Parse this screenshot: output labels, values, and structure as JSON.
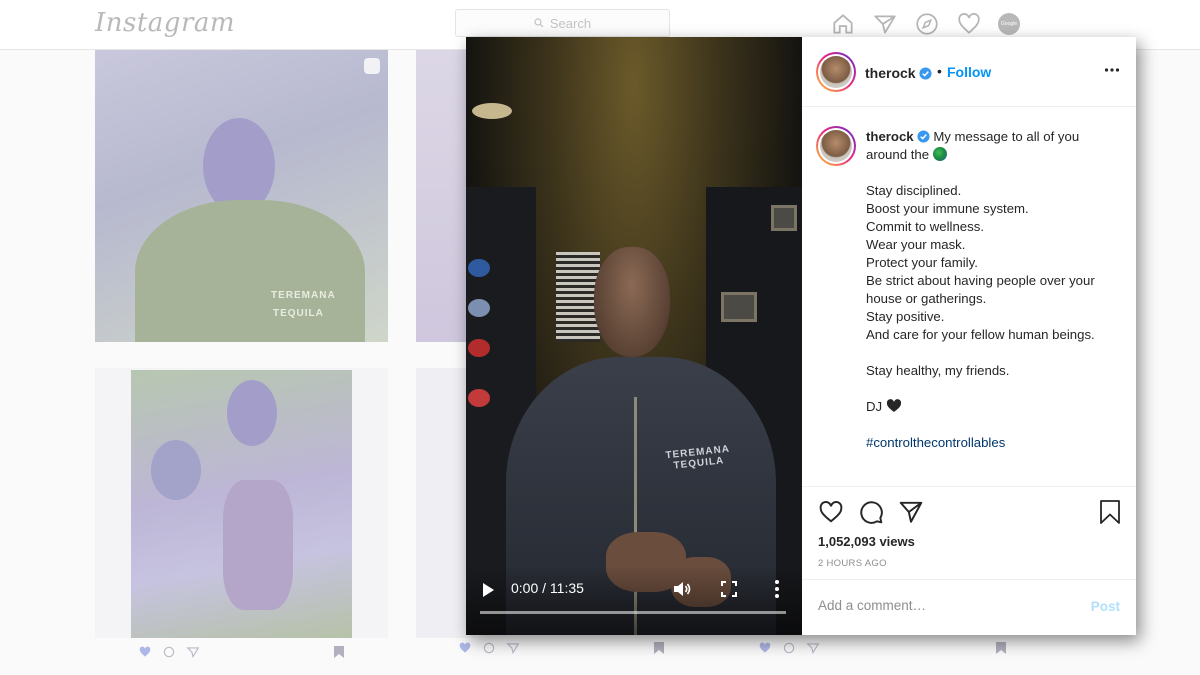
{
  "topnav": {
    "logo": "Instagram",
    "search_placeholder": "Search",
    "avatar_label": "Google"
  },
  "background_tiles": {
    "hoodie_text_top": "TEREMANA",
    "hoodie_text_bottom": "TEQUILA"
  },
  "video": {
    "time": "0:00 / 11:35",
    "progress": 0.0,
    "hoodie_text_top": "TEREMANA",
    "hoodie_text_bottom": "TEQUILA"
  },
  "post": {
    "username": "therock",
    "separator": "•",
    "follow_label": "Follow",
    "caption_intro": "My message to all of you around the",
    "caption_lines": [
      "Stay disciplined.",
      "Boost your immune system.",
      "Commit to wellness.",
      "Wear your mask.",
      "Protect your family.",
      "Be strict about having people over your house or gatherings.",
      "Stay positive.",
      "And care for your fellow human beings."
    ],
    "closing": "Stay healthy, my friends.",
    "signature": "DJ",
    "hashtag": "#controlthecontrollables",
    "views": "1,052,093 views",
    "time_ago": "2 HOURS AGO",
    "comment_placeholder": "Add a comment…",
    "post_label": "Post"
  },
  "colors": {
    "accent": "#0095f6",
    "verified": "#3897f0",
    "hashtag": "#00376b"
  },
  "icons": [
    "home-icon",
    "direct-icon",
    "explore-icon",
    "activity-icon",
    "like-icon",
    "comment-icon",
    "share-icon",
    "save-icon",
    "play-icon",
    "volume-icon",
    "fullscreen-icon",
    "more-options-icon"
  ]
}
